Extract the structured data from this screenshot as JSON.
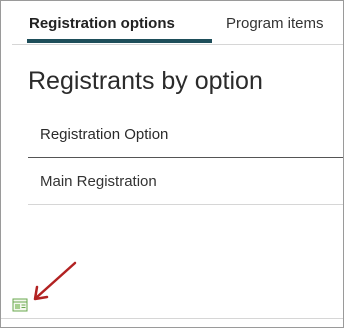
{
  "tabs": [
    {
      "label": "Registration options",
      "active": true
    },
    {
      "label": "Program items",
      "active": false
    }
  ],
  "panel": {
    "title": "Registrants by option"
  },
  "table": {
    "header": "Registration Option",
    "rows": [
      "Main Registration"
    ]
  },
  "colors": {
    "active_tab_underline": "#1e4e5a",
    "annotation_arrow": "#b22222",
    "icon_green": "#6aa84f"
  },
  "icons": {
    "bottom_icon": "layout-panel-icon",
    "annotation": "red-arrow-annotation"
  }
}
